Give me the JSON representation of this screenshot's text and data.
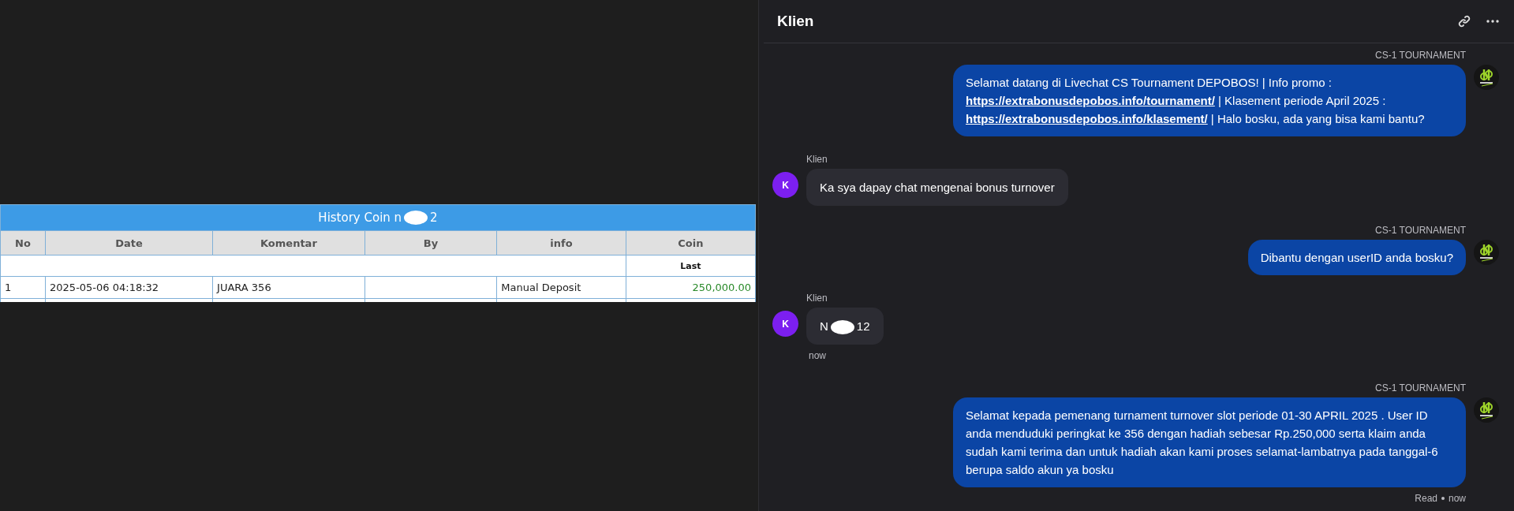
{
  "history_table": {
    "title_parts": [
      "History Coin n",
      "2"
    ],
    "columns": [
      "No",
      "Date",
      "Komentar",
      "By",
      "info",
      "Coin"
    ],
    "subheader": {
      "coin": "Last"
    },
    "rows": [
      {
        "no": "1",
        "date": "2025-05-06 04:18:32",
        "komentar": "JUARA 356",
        "info": "Manual Deposit",
        "coin": "250,000.00"
      }
    ]
  },
  "chat": {
    "title": "Klien",
    "messages": [
      {
        "kind": "agent",
        "sender": "CS-1 TOURNAMENT",
        "segments": [
          {
            "kind": "text",
            "text": "Selamat datang di Livechat CS Tournament DEPOBOS! | Info promo : "
          },
          {
            "kind": "link",
            "text": "https://extrabonusdepobos.info/tournament/"
          },
          {
            "kind": "text",
            "text": " | Klasement periode April 2025 : "
          },
          {
            "kind": "link",
            "text": "https://extrabonusdepobos.info/klasement/"
          },
          {
            "kind": "text",
            "text": " | Halo bosku, ada yang bisa kami bantu?"
          }
        ]
      },
      {
        "kind": "client",
        "sender": "Klien",
        "avatar": "K",
        "segments": [
          {
            "kind": "text",
            "text": "Ka sya dapay chat mengenai bonus turnover"
          }
        ]
      },
      {
        "kind": "agent",
        "sender": "CS-1 TOURNAMENT",
        "segments": [
          {
            "kind": "text",
            "text": "Dibantu dengan userID anda bosku?"
          }
        ]
      },
      {
        "kind": "client",
        "sender": "Klien",
        "avatar": "K",
        "segments": [
          {
            "kind": "text",
            "text": "N"
          },
          {
            "kind": "redacted"
          },
          {
            "kind": "text",
            "text": "12"
          }
        ],
        "time": "now"
      },
      {
        "kind": "agent",
        "sender": "CS-1 TOURNAMENT",
        "segments": [
          {
            "kind": "text",
            "text": "Selamat kepada pemenang turnament turnover slot periode 01-30 APRIL 2025 . User ID anda menduduki peringkat ke 356 dengan hadiah sebesar Rp.250,000 serta klaim anda sudah kami terima dan untuk hadiah akan kami proses selamat-lambatnya pada tanggal-6 berupa saldo akun ya bosku"
          }
        ],
        "status": "Read",
        "time": "now"
      }
    ]
  }
}
